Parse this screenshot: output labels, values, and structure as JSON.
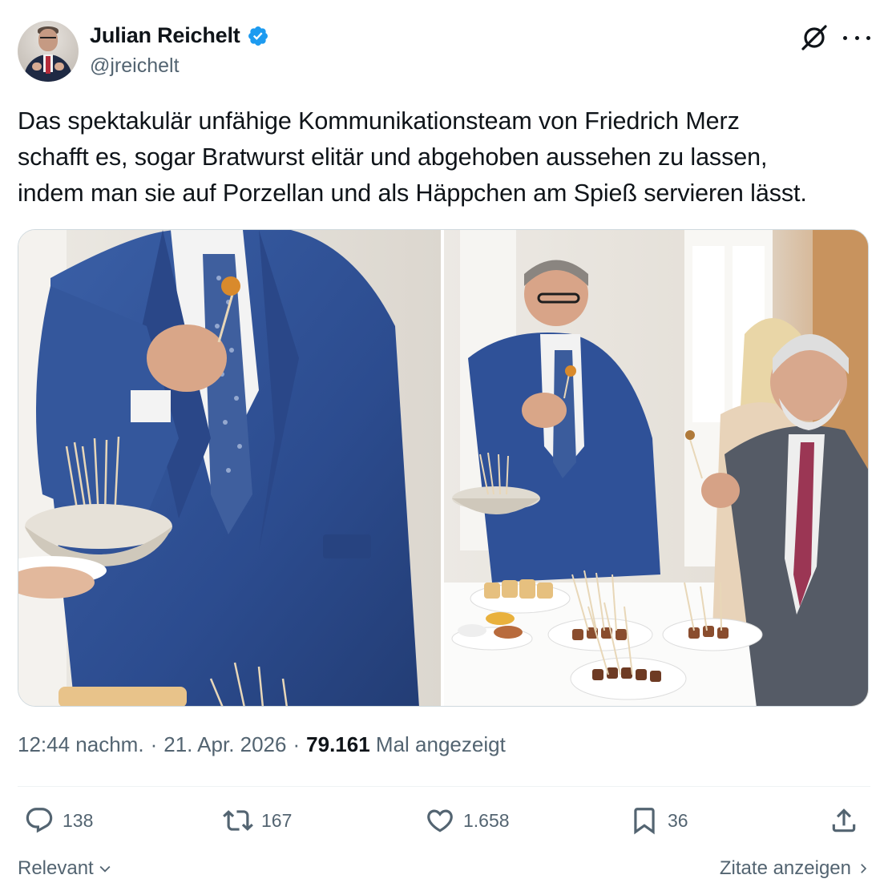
{
  "author": {
    "display_name": "Julian Reichelt",
    "handle": "@jreichelt",
    "verified": true,
    "verified_color": "#1d9bf0"
  },
  "header_icons": [
    "grok-icon",
    "more-options-icon"
  ],
  "tweet": {
    "text": "Das spektakulär unfähige Kommunikationsteam von Friedrich Merz\nschafft es, sogar Bratwurst elitär und abgehoben aussehen zu lassen,\nindem man sie auf Porzellan und als Häppchen am Spieß servieren lässt."
  },
  "media": {
    "count": 2
  },
  "meta": {
    "time": "12:44 nachm.",
    "separator": "·",
    "date": "21. Apr. 2026",
    "views_count": "79.161",
    "views_label": "Mal angezeigt"
  },
  "actions": {
    "replies": "138",
    "reposts": "167",
    "likes": "1.658",
    "bookmarks": "36"
  },
  "footer": {
    "sort_label": "Relevant",
    "quotes_label": "Zitate anzeigen"
  },
  "colors": {
    "text_primary": "#0f1419",
    "text_secondary": "#536471",
    "accent": "#1d9bf0",
    "border": "#cfd9de"
  }
}
